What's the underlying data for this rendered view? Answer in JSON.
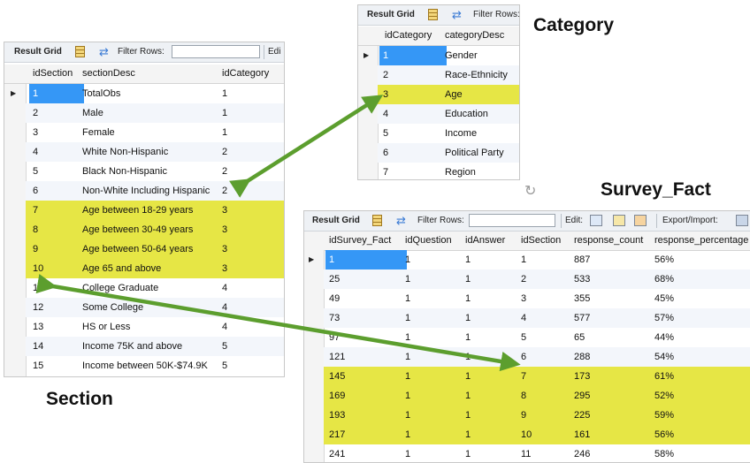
{
  "labels": {
    "category": "Category",
    "survey_fact": "Survey_Fact",
    "section": "Section"
  },
  "toolbar": {
    "result_grid": "Result Grid",
    "filter_rows": "Filter Rows:",
    "edit_cut": "Edi",
    "edit": "Edit:",
    "export_import": "Export/Import:"
  },
  "section_table": {
    "columns": [
      "idSection",
      "sectionDesc",
      "idCategory"
    ],
    "rows": [
      [
        "1",
        "TotalObs",
        "1"
      ],
      [
        "2",
        "Male",
        "1"
      ],
      [
        "3",
        "Female",
        "1"
      ],
      [
        "4",
        "White Non-Hispanic",
        "2"
      ],
      [
        "5",
        "Black Non-Hispanic",
        "2"
      ],
      [
        "6",
        "Non-White Including Hispanic",
        "2"
      ],
      [
        "7",
        "Age between 18-29 years",
        "3"
      ],
      [
        "8",
        "Age between 30-49 years",
        "3"
      ],
      [
        "9",
        "Age between 50-64 years",
        "3"
      ],
      [
        "10",
        "Age 65 and above",
        "3"
      ],
      [
        "11",
        "College Graduate",
        "4"
      ],
      [
        "12",
        "Some College",
        "4"
      ],
      [
        "13",
        "HS or Less",
        "4"
      ],
      [
        "14",
        "Income 75K and above",
        "5"
      ],
      [
        "15",
        "Income between 50K-$74.9K",
        "5"
      ]
    ],
    "highlighted_rows": [
      6,
      7,
      8,
      9
    ]
  },
  "category_table": {
    "columns": [
      "idCategory",
      "categoryDesc"
    ],
    "rows": [
      [
        "1",
        "Gender"
      ],
      [
        "2",
        "Race-Ethnicity"
      ],
      [
        "3",
        "Age"
      ],
      [
        "4",
        "Education"
      ],
      [
        "5",
        "Income"
      ],
      [
        "6",
        "Political Party"
      ],
      [
        "7",
        "Region"
      ]
    ],
    "highlighted_rows": [
      2
    ]
  },
  "survey_fact_table": {
    "columns": [
      "idSurvey_Fact",
      "idQuestion",
      "idAnswer",
      "idSection",
      "response_count",
      "response_percentage"
    ],
    "rows": [
      [
        "1",
        "1",
        "1",
        "1",
        "887",
        "56%"
      ],
      [
        "25",
        "1",
        "1",
        "2",
        "533",
        "68%"
      ],
      [
        "49",
        "1",
        "1",
        "3",
        "355",
        "45%"
      ],
      [
        "73",
        "1",
        "1",
        "4",
        "577",
        "57%"
      ],
      [
        "97",
        "1",
        "1",
        "5",
        "65",
        "44%"
      ],
      [
        "121",
        "1",
        "1",
        "6",
        "288",
        "54%"
      ],
      [
        "145",
        "1",
        "1",
        "7",
        "173",
        "61%"
      ],
      [
        "169",
        "1",
        "1",
        "8",
        "295",
        "52%"
      ],
      [
        "193",
        "1",
        "1",
        "9",
        "225",
        "59%"
      ],
      [
        "217",
        "1",
        "1",
        "10",
        "161",
        "56%"
      ],
      [
        "241",
        "1",
        "1",
        "11",
        "246",
        "58%"
      ]
    ],
    "highlighted_rows": [
      6,
      7,
      8,
      9
    ]
  },
  "colors": {
    "highlight": "#e6e645",
    "selected_cell": "#3597f6",
    "arrow": "#5c9e2e"
  }
}
